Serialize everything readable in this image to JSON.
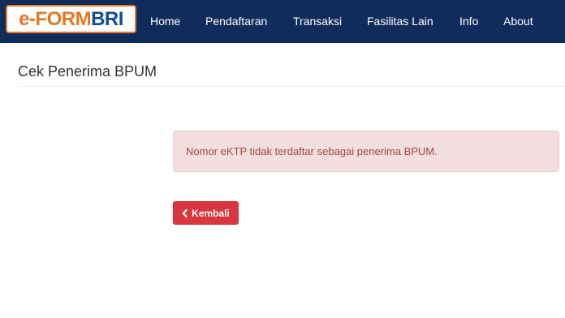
{
  "brand": {
    "logo_part1": "e-FORM",
    "logo_part2": "BRI",
    "orange": "#e87722",
    "blue": "#0f4c92"
  },
  "navbar": {
    "bg_color": "#0f2c5c",
    "items": [
      {
        "label": "Home"
      },
      {
        "label": "Pendaftaran"
      },
      {
        "label": "Transaksi"
      },
      {
        "label": "Fasilitas Lain"
      },
      {
        "label": "Info"
      },
      {
        "label": "About"
      }
    ]
  },
  "page": {
    "title": "Cek Penerima BPUM"
  },
  "alert": {
    "message": "Nomor eKTP tidak terdaftar sebagai penerima BPUM.",
    "bg_color": "#f2dede",
    "text_color": "#a94442"
  },
  "back_button": {
    "icon": "chevron-left-icon",
    "label": "Kembali",
    "color": "#d9363e"
  }
}
